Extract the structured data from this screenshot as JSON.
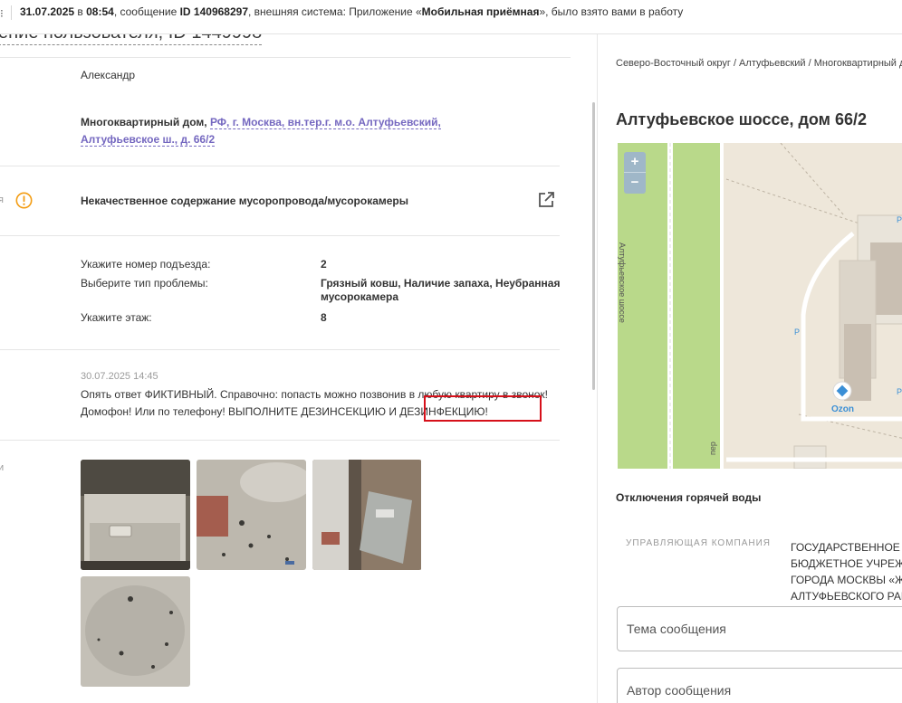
{
  "notification": {
    "menu_glyph": "⁝",
    "date": "31.07.2025",
    "at": " в ",
    "time": "08:54",
    "part1": ", сообщение ",
    "id_text": "ID 140968297",
    "part2": ", внешняя система: Приложение «",
    "system": "Мобильная приёмная",
    "part3": "», было взято вами в работу"
  },
  "left": {
    "page_title_partial": "ение пользователя, ID 1449998",
    "author_name": "Александр",
    "address_prefix": "Многоквартирный дом, ",
    "address_link": "РФ, г. Москва, вн.тер.г. м.о. Алтуфьевский, Алтуфьевское ш., д. 66/2",
    "category_label_partial": "я",
    "category": "Некачественное содержание мусоропровода/мусорокамеры",
    "fields": [
      {
        "label": "Укажите номер подъезда:",
        "value": "2"
      },
      {
        "label": "Выберите тип проблемы:",
        "value": "Грязный ковш, Наличие запаха, Неубранная мусорокамера"
      },
      {
        "label": "Укажите этаж:",
        "value": "8"
      }
    ],
    "comment": {
      "date": "30.07.2025 14:45",
      "text": "Опять ответ ФИКТИВНЫЙ. Справочно: попасть можно позвонив в любую квартиру в звонок! Домофон! Или по телефону! ВЫПОЛНИТЕ ДЕЗИНСЕКЦИЮ И ДЕЗИНФЕКЦИЮ!"
    },
    "photos_label_partial": "и",
    "photos": [
      "photo-1",
      "photo-2",
      "photo-3",
      "photo-4"
    ]
  },
  "right": {
    "breadcrumb": "Северо-Восточный округ / Алтуфьевский / Многоквартирный дом",
    "title": "Алтуфьевское шоссе, дом 66/2",
    "map": {
      "zoom_in": "+",
      "zoom_out": "−",
      "street_label": "Алтуфьевское шоссе",
      "ozon_label": "Ozon",
      "parking_glyph": "P",
      "lane_label": "пер",
      "colors": {
        "grass": "#b9d98a",
        "ground": "#eee7da",
        "building": "#c9bfb2",
        "road": "#ffffff",
        "poi": "#3a8fd6"
      }
    },
    "hot_water_title": "Отключения горячей воды",
    "management_company_label": "УПРАВЛЯЮЩАЯ КОМПАНИЯ",
    "management_company_value": "ГОСУДАРСТВЕННОЕ БЮДЖЕТНОЕ УЧРЕЖДЕНИЕ ГОРОДА МОСКВЫ «ЖИЛИЩНИК АЛТУФЬЕВСКОГО РАЙОНА»",
    "subject_placeholder": "Тема сообщения",
    "author_placeholder": "Автор сообщения"
  },
  "colors": {
    "accent_link": "#7568c0",
    "warning": "#f39c12",
    "highlight": "#d6101a"
  }
}
